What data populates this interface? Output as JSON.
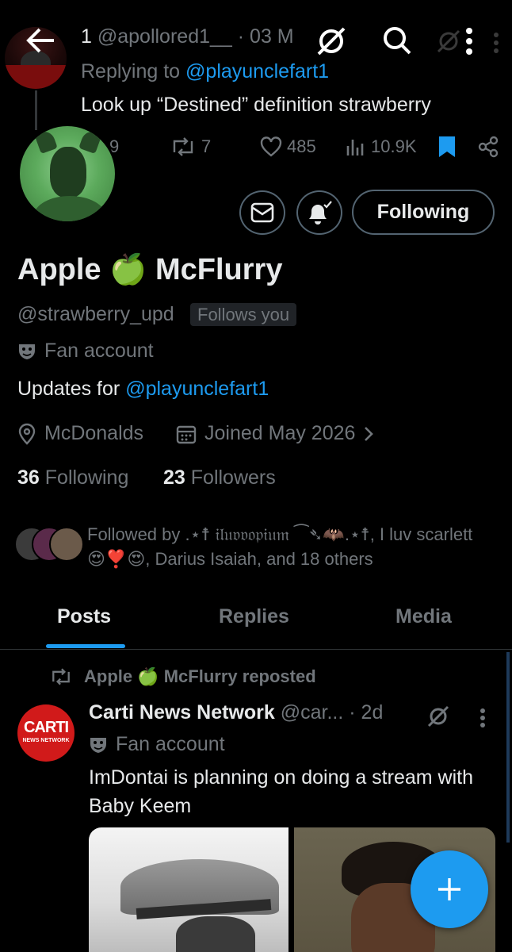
{
  "colors": {
    "accent": "#1d9bf0",
    "muted": "#71767b",
    "text": "#e7e9ea",
    "background": "#000000"
  },
  "header_tweet": {
    "reply_count": "1",
    "handle": "@apollored1__",
    "separator": "·",
    "date": "03 M",
    "replying_prefix": "Replying to",
    "replying_to": "@playunclefart1",
    "text": "Look up “Destined” definition strawberry",
    "comments": "9",
    "reposts": "7",
    "likes": "485",
    "views": "10.9K"
  },
  "profile": {
    "display_name": "Apple 🍏 McFlurry",
    "handle": "@strawberry_upd",
    "follows_you": "Follows you",
    "category": "Fan account",
    "bio_prefix": "Updates for",
    "bio_link": "@playunclefart1",
    "location": "McDonalds",
    "joined": "Joined May 2026",
    "following_count": "36",
    "following_label": "Following",
    "followers_count": "23",
    "followers_label": "Followers",
    "follow_button": "Following",
    "followed_by": "Followed by .⋆☨ 𝔦𝔩𝔲𝔳𝔳𝔬𝔭𝔦𝔲𝔪 ⁀➴🦇.⋆☨, I luv scarlett 😍❣️😍, Darius Isaiah, and 18 others"
  },
  "tabs": [
    "Posts",
    "Replies",
    "Media"
  ],
  "post": {
    "repost_label": "Apple 🍏 McFlurry reposted",
    "author": "Carti News Network",
    "handle": "@car...",
    "time": "· 2d",
    "category": "Fan account",
    "text": "ImDontai is planning on doing a stream with Baby Keem",
    "avatar_text": "CARTI",
    "avatar_subtext": "NEWS NETWORK"
  },
  "icons": [
    "back-arrow-icon",
    "grok-icon",
    "search-icon",
    "more-vertical-icon",
    "reply-icon",
    "repost-icon",
    "like-icon",
    "views-icon",
    "bookmark-icon",
    "share-icon",
    "mail-icon",
    "bell-icon",
    "mask-icon",
    "location-icon",
    "calendar-icon",
    "chevron-right-icon",
    "compose-plus-icon"
  ]
}
